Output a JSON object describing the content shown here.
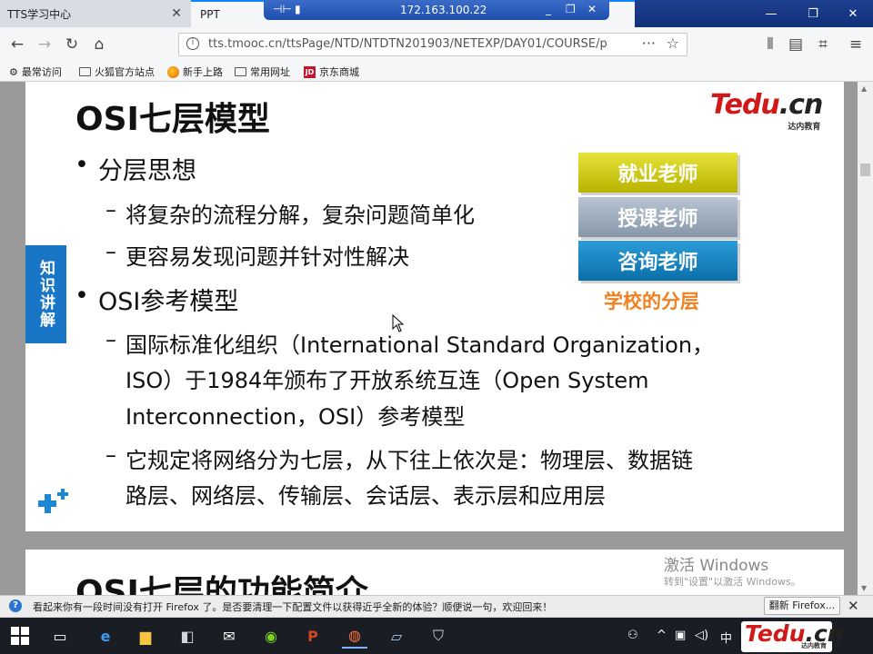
{
  "browser": {
    "tabs": [
      {
        "label": "TTS学习中心",
        "active": false
      },
      {
        "label": "PPT",
        "active": true
      }
    ],
    "remote_ip": "172.163.100.22",
    "url": "tts.tmooc.cn/ttsPage/NTD/NTDTN201903/NETEXP/DAY01/COURSE/ppt",
    "bookmarks": [
      "最常访问",
      "火狐官方站点",
      "新手上路",
      "常用网址",
      "京东商城"
    ]
  },
  "slide": {
    "title": "OSI七层模型",
    "logo_brand": "Tedu",
    "logo_domain": ".cn",
    "logo_sub": "达内教育",
    "side_tag": "知识讲解",
    "bullets": {
      "b1": "分层思想",
      "b1_s1": "将复杂的流程分解，复杂问题简单化",
      "b1_s2": "更容易发现问题并针对性解决",
      "b2": "OSI参考模型",
      "b2_s1_l1": "国际标准化组织（International Standard Organization，",
      "b2_s1_l2": "ISO）于1984年颁布了开放系统互连（Open System",
      "b2_s1_l3": "Interconnection，OSI）参考模型",
      "b2_s2_l1": "它规定将网络分为七层，从下往上依次是：物理层、数据链",
      "b2_s2_l2": "路层、网络层、传输层、会话层、表示层和应用层"
    },
    "bullet_glyph": "•",
    "dash_glyph": "–",
    "ladder": [
      "就业老师",
      "授课老师",
      "咨询老师"
    ],
    "ladder_caption": "学校的分层",
    "next_slide_peek": "OSI七层的功能简介"
  },
  "windows_watermark": {
    "line1": "激活 Windows",
    "line2": "转到\"设置\"以激活 Windows。"
  },
  "notification": {
    "message": "看起来你有一段时间没有打开 Firefox 了。是否要清理一下配置文件以获得近乎全新的体验？顺便说一句，欢迎回来！",
    "button": "翻新 Firefox..."
  },
  "taskbar": {
    "ime": "中",
    "logo_brand": "Tedu",
    "logo_domain": ".cn",
    "logo_sub": "达内教育"
  },
  "colors": {
    "ladder_top": "#d4cf1c",
    "ladder_mid": "#9eabbb",
    "ladder_bottom": "#1a86c4",
    "caption": "#f08020",
    "side_tag": "#1976c6"
  }
}
